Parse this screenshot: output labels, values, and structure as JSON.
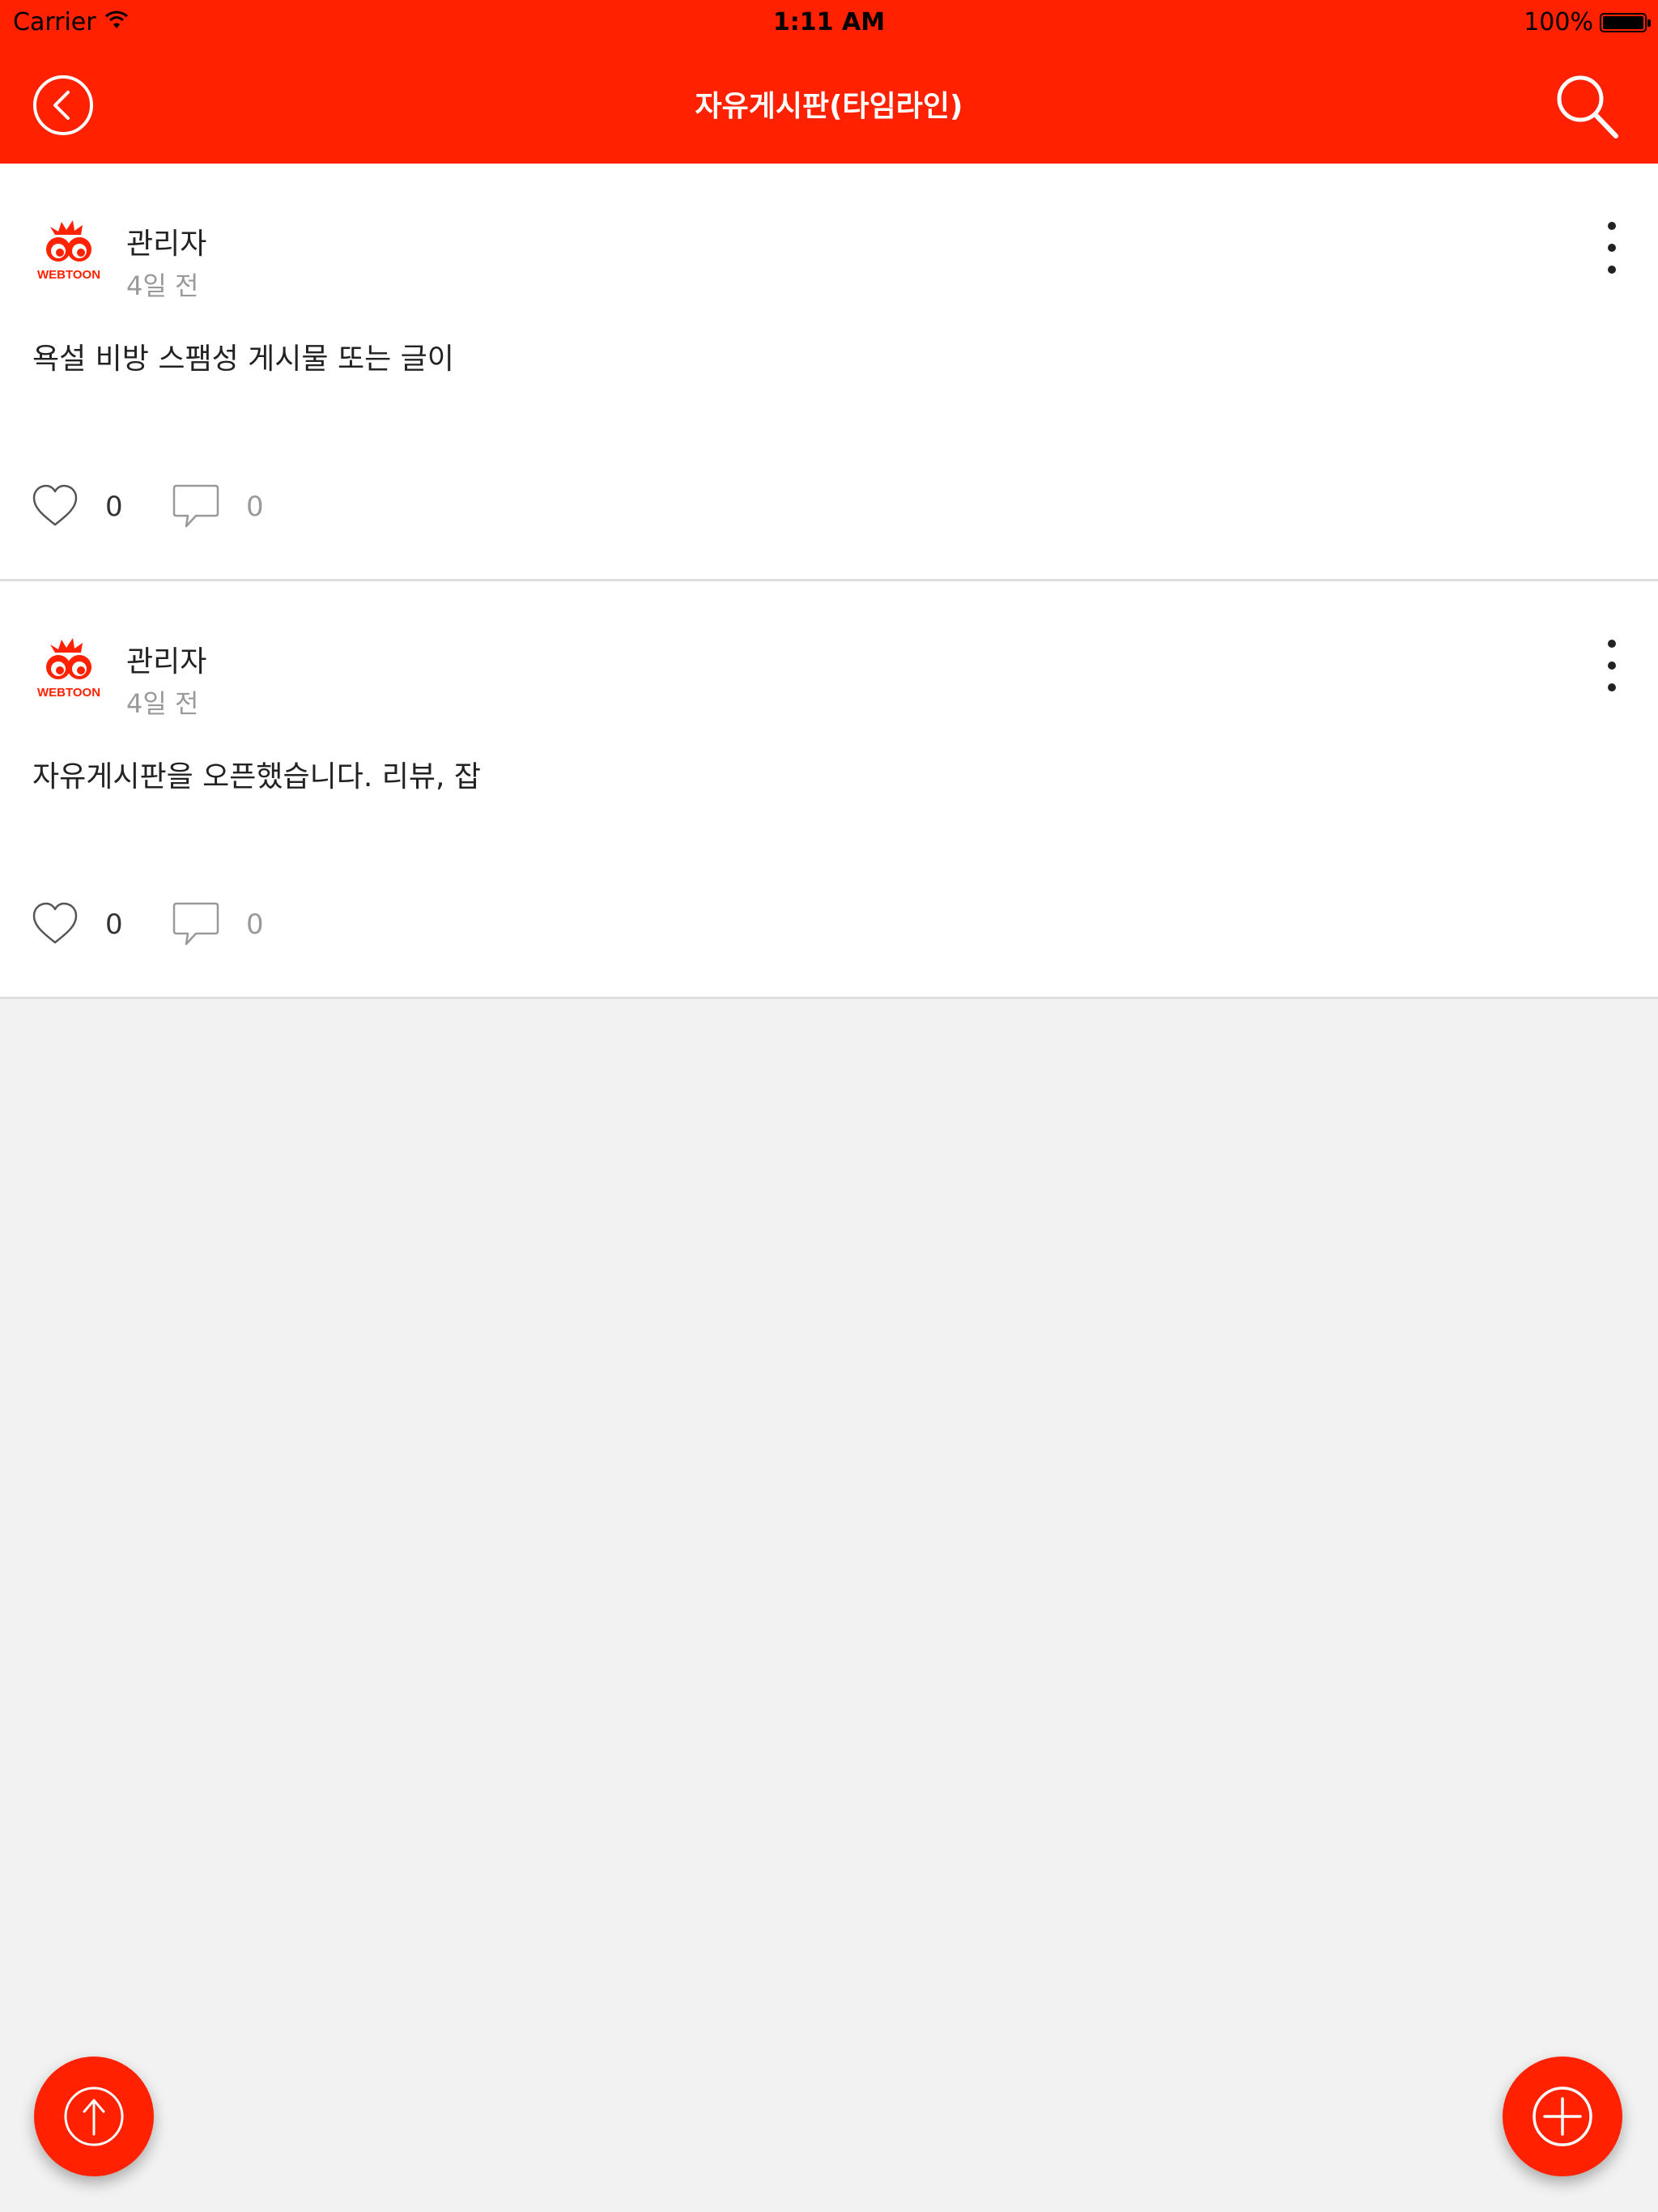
{
  "status_bar": {
    "carrier": "Carrier",
    "time": "1:11 AM",
    "battery": "100%"
  },
  "nav": {
    "title": "자유게시판(타임라인)",
    "back_icon": "chevron-left-circle-icon",
    "search_icon": "search-icon"
  },
  "colors": {
    "brand": "#ff2100",
    "background": "#f2f2f2"
  },
  "posts": [
    {
      "author": "관리자",
      "time": "4일 전",
      "content": "욕설 비방 스팸성 게시물 또는 글이",
      "likes": "0",
      "comments": "0"
    },
    {
      "author": "관리자",
      "time": "4일 전",
      "content": "자유게시판을 오픈했습니다. 리뷰, 잡",
      "likes": "0",
      "comments": "0"
    }
  ],
  "fabs": {
    "scroll_top_icon": "arrow-up-circle-icon",
    "add_icon": "plus-circle-icon"
  }
}
